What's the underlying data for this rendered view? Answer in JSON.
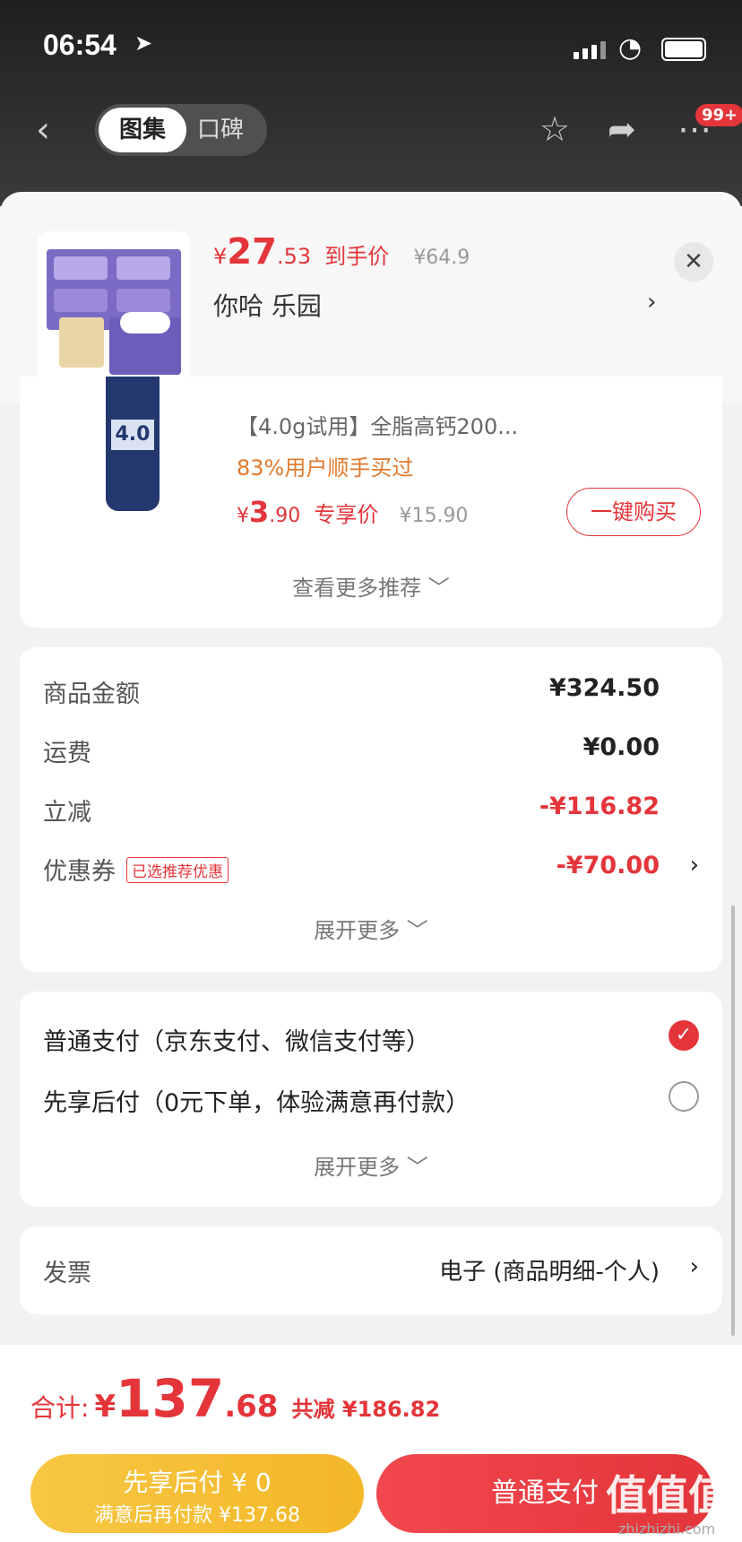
{
  "status": {
    "time": "06:54"
  },
  "nav": {
    "tab_active": "图集",
    "tab_inactive": "口碑",
    "badge": "99+"
  },
  "floating_product": {
    "currency": "¥",
    "price_int": "27",
    "price_dec": ".53",
    "price_tag": "到手价",
    "orig_price": "¥64.9",
    "shop": "你哈  乐园"
  },
  "recommend": {
    "title": "【4.0g试用】全脂高钙200...",
    "bought": "83%用户顺手买过",
    "currency": "¥",
    "price_int": "3",
    "price_dec": ".90",
    "price_tag": "专享价",
    "orig_price": "¥15.90",
    "bottle_label": "4.0",
    "buy_label": "一键购买",
    "more_label": "查看更多推荐 ﹀"
  },
  "amounts": {
    "rows": [
      {
        "label": "商品金额",
        "value": "¥324.50"
      },
      {
        "label": "运费",
        "value": "¥0.00"
      },
      {
        "label": "立减",
        "value": "-¥116.82"
      },
      {
        "label": "优惠券",
        "value": "-¥70.00",
        "tag": "已选推荐优惠"
      }
    ],
    "more_label": "展开更多 ﹀"
  },
  "payment": {
    "options": [
      {
        "label": "普通支付（京东支付、微信支付等）",
        "selected": true
      },
      {
        "label": "先享后付（0元下单，体验满意再付款）",
        "selected": false
      }
    ],
    "more_label": "展开更多 ﹀"
  },
  "invoice": {
    "label": "发票",
    "value": "电子 (商品明细-个人)"
  },
  "footer": {
    "total_label": "合计:",
    "currency": "¥",
    "total_int": "137",
    "total_dec": ".68",
    "save_text": "共减 ¥186.82",
    "later_line1": "先享后付 ¥ 0",
    "later_line2": "满意后再付款 ¥137.68",
    "pay_label": "普通支付",
    "watermark": "值值值",
    "watermark_sub": "zhizhizhi.com"
  },
  "colors": {
    "accent": "#e3353a",
    "later": "#f5c03a"
  }
}
